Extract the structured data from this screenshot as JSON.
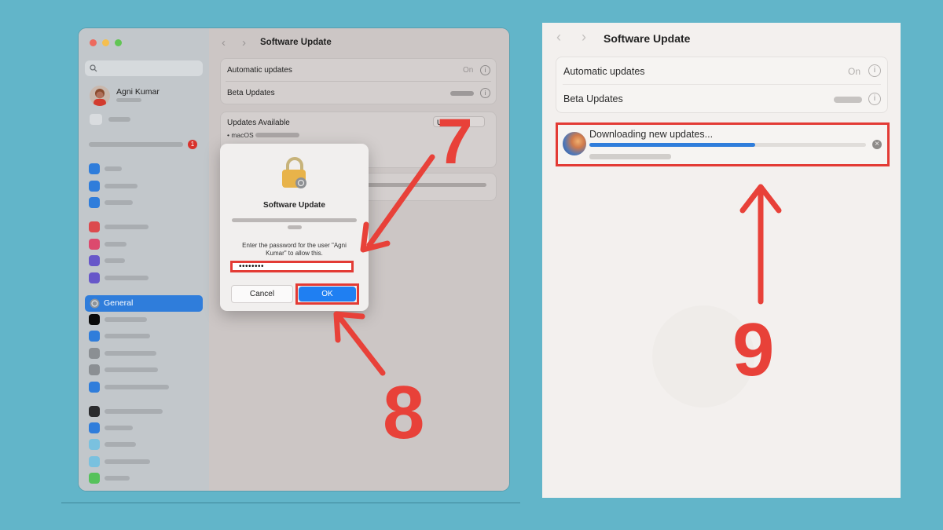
{
  "left_window": {
    "title": "Software Update",
    "user_name": "Agni Kumar",
    "sidebar_badge": "1",
    "sidebar_selected": "General",
    "rows": {
      "automatic_updates_label": "Automatic updates",
      "automatic_updates_value": "On",
      "beta_updates_label": "Beta Updates"
    },
    "updates_available": {
      "title": "Updates Available",
      "item": "• macOS",
      "button_label": "U"
    },
    "dialog": {
      "title": "Software Update",
      "message": "Enter the password for the user \"Agni Kumar\" to allow this.",
      "password_value": "••••••••",
      "cancel_label": "Cancel",
      "ok_label": "OK"
    }
  },
  "right_panel": {
    "title": "Software Update",
    "automatic_updates_label": "Automatic updates",
    "automatic_updates_value": "On",
    "beta_updates_label": "Beta Updates",
    "download_text": "Downloading new updates...",
    "download_progress": 0.6
  },
  "annotations": {
    "step7": "7",
    "step8": "8",
    "step9": "9"
  },
  "colors": {
    "background": "#62b5c9",
    "annotation_red": "#e84139",
    "accent_blue": "#2f7ddb",
    "close_red": "#ed6a5e",
    "minimize_yellow": "#f5bf4f",
    "maximize_green": "#61c554"
  }
}
